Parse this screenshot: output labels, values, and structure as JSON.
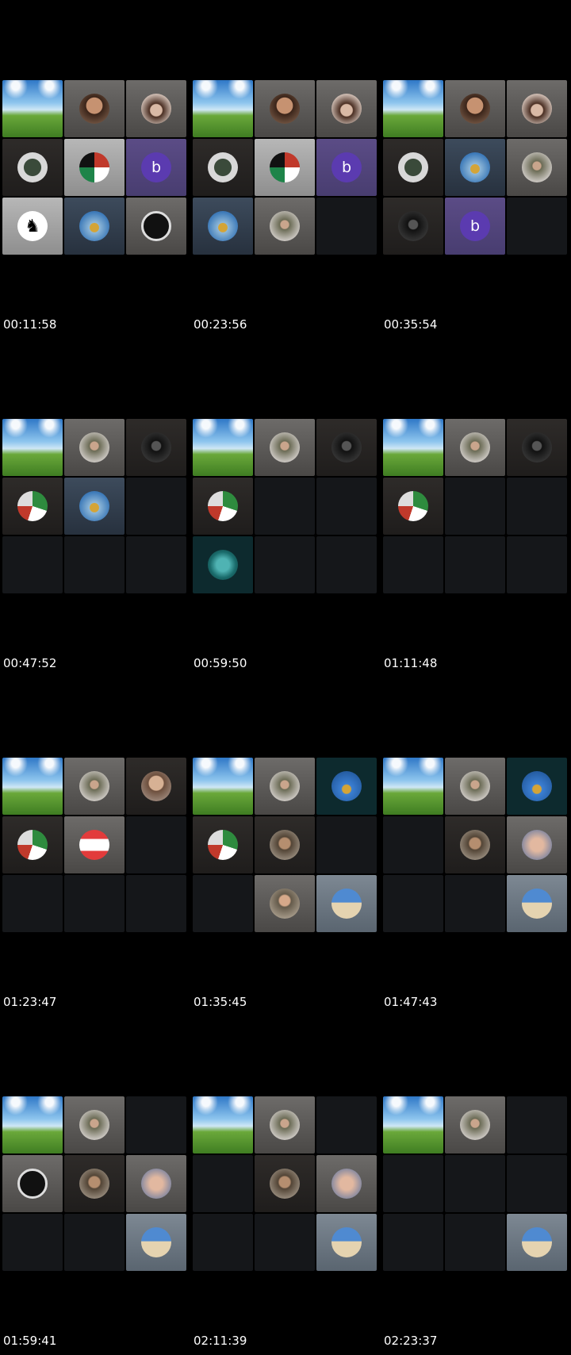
{
  "frames": [
    {
      "timestamp": "00:11:58",
      "tiles": [
        {
          "bg": "stadium",
          "avatar": null
        },
        {
          "bg": "grey",
          "avatar": "man"
        },
        {
          "bg": "grey",
          "avatar": "girl"
        },
        {
          "bg": "dark",
          "avatar": "soldiers"
        },
        {
          "bg": "light",
          "avatar": "flags"
        },
        {
          "bg": "purple",
          "avatar": "letter",
          "letter": "b"
        },
        {
          "bg": "light",
          "avatar": "horse"
        },
        {
          "bg": "blue",
          "avatar": "dome"
        },
        {
          "bg": "grey",
          "avatar": "default"
        }
      ]
    },
    {
      "timestamp": "00:23:56",
      "tiles": [
        {
          "bg": "stadium",
          "avatar": null
        },
        {
          "bg": "grey",
          "avatar": "man"
        },
        {
          "bg": "grey",
          "avatar": "girl"
        },
        {
          "bg": "dark",
          "avatar": "soldiers"
        },
        {
          "bg": "light",
          "avatar": "flags"
        },
        {
          "bg": "purple",
          "avatar": "letter",
          "letter": "b"
        },
        {
          "bg": "blue",
          "avatar": "dome"
        },
        {
          "bg": "grey",
          "avatar": "fighter"
        },
        {
          "bg": "empty",
          "avatar": null
        }
      ]
    },
    {
      "timestamp": "00:35:54",
      "tiles": [
        {
          "bg": "stadium",
          "avatar": null
        },
        {
          "bg": "grey",
          "avatar": "man"
        },
        {
          "bg": "grey",
          "avatar": "girl"
        },
        {
          "bg": "dark",
          "avatar": "soldiers"
        },
        {
          "bg": "blue",
          "avatar": "dome"
        },
        {
          "bg": "grey",
          "avatar": "fighter"
        },
        {
          "bg": "dark",
          "avatar": "masked"
        },
        {
          "bg": "purple",
          "avatar": "letter",
          "letter": "b"
        },
        {
          "bg": "empty",
          "avatar": null
        }
      ]
    },
    {
      "timestamp": "00:47:52",
      "tiles": [
        {
          "bg": "stadium",
          "avatar": null
        },
        {
          "bg": "grey",
          "avatar": "fighter"
        },
        {
          "bg": "dark",
          "avatar": "masked"
        },
        {
          "bg": "dark",
          "avatar": "keffiyeh"
        },
        {
          "bg": "blue",
          "avatar": "dome"
        },
        {
          "bg": "empty",
          "avatar": null
        },
        {
          "bg": "empty",
          "avatar": null
        },
        {
          "bg": "empty",
          "avatar": null
        },
        {
          "bg": "empty",
          "avatar": null
        }
      ]
    },
    {
      "timestamp": "00:59:50",
      "tiles": [
        {
          "bg": "stadium",
          "avatar": null
        },
        {
          "bg": "grey",
          "avatar": "fighter"
        },
        {
          "bg": "dark",
          "avatar": "masked"
        },
        {
          "bg": "dark",
          "avatar": "keffiyeh"
        },
        {
          "bg": "empty",
          "avatar": null
        },
        {
          "bg": "empty",
          "avatar": null
        },
        {
          "bg": "teal",
          "avatar": "teal"
        },
        {
          "bg": "empty",
          "avatar": null
        },
        {
          "bg": "empty",
          "avatar": null
        }
      ]
    },
    {
      "timestamp": "01:11:48",
      "tiles": [
        {
          "bg": "stadium",
          "avatar": null
        },
        {
          "bg": "grey",
          "avatar": "fighter"
        },
        {
          "bg": "dark",
          "avatar": "masked"
        },
        {
          "bg": "dark",
          "avatar": "keffiyeh"
        },
        {
          "bg": "empty",
          "avatar": null
        },
        {
          "bg": "empty",
          "avatar": null
        },
        {
          "bg": "empty",
          "avatar": null
        },
        {
          "bg": "empty",
          "avatar": null
        },
        {
          "bg": "empty",
          "avatar": null
        }
      ]
    },
    {
      "timestamp": "01:23:47",
      "tiles": [
        {
          "bg": "stadium",
          "avatar": null
        },
        {
          "bg": "grey",
          "avatar": "fighter"
        },
        {
          "bg": "dark",
          "avatar": "man2"
        },
        {
          "bg": "dark",
          "avatar": "keffiyeh"
        },
        {
          "bg": "grey",
          "avatar": "lebanon"
        },
        {
          "bg": "empty",
          "avatar": null
        },
        {
          "bg": "empty",
          "avatar": null
        },
        {
          "bg": "empty",
          "avatar": null
        },
        {
          "bg": "empty",
          "avatar": null
        }
      ]
    },
    {
      "timestamp": "01:35:45",
      "tiles": [
        {
          "bg": "stadium",
          "avatar": null
        },
        {
          "bg": "grey",
          "avatar": "fighter"
        },
        {
          "bg": "teal",
          "avatar": "flagdome"
        },
        {
          "bg": "dark",
          "avatar": "keffiyeh"
        },
        {
          "bg": "dark",
          "avatar": "men"
        },
        {
          "bg": "empty",
          "avatar": null
        },
        {
          "bg": "empty",
          "avatar": null
        },
        {
          "bg": "grey",
          "avatar": "selfie"
        },
        {
          "bg": "steel",
          "avatar": "beach"
        }
      ]
    },
    {
      "timestamp": "01:47:43",
      "tiles": [
        {
          "bg": "stadium",
          "avatar": null
        },
        {
          "bg": "grey",
          "avatar": "fighter"
        },
        {
          "bg": "teal",
          "avatar": "flagdome"
        },
        {
          "bg": "empty",
          "avatar": null
        },
        {
          "bg": "dark",
          "avatar": "men"
        },
        {
          "bg": "grey",
          "avatar": "hands"
        },
        {
          "bg": "empty",
          "avatar": null
        },
        {
          "bg": "empty",
          "avatar": null
        },
        {
          "bg": "steel",
          "avatar": "beach"
        }
      ]
    },
    {
      "timestamp": "01:59:41",
      "tiles": [
        {
          "bg": "stadium",
          "avatar": null
        },
        {
          "bg": "grey",
          "avatar": "fighter"
        },
        {
          "bg": "empty",
          "avatar": null
        },
        {
          "bg": "grey",
          "avatar": "default"
        },
        {
          "bg": "dark",
          "avatar": "men"
        },
        {
          "bg": "grey",
          "avatar": "hands"
        },
        {
          "bg": "empty",
          "avatar": null
        },
        {
          "bg": "empty",
          "avatar": null
        },
        {
          "bg": "steel",
          "avatar": "beach"
        }
      ]
    },
    {
      "timestamp": "02:11:39",
      "tiles": [
        {
          "bg": "stadium",
          "avatar": null
        },
        {
          "bg": "grey",
          "avatar": "fighter"
        },
        {
          "bg": "empty",
          "avatar": null
        },
        {
          "bg": "empty",
          "avatar": null
        },
        {
          "bg": "dark",
          "avatar": "men"
        },
        {
          "bg": "grey",
          "avatar": "hands"
        },
        {
          "bg": "empty",
          "avatar": null
        },
        {
          "bg": "empty",
          "avatar": null
        },
        {
          "bg": "steel",
          "avatar": "beach"
        }
      ]
    },
    {
      "timestamp": "02:23:37",
      "tiles": [
        {
          "bg": "stadium",
          "avatar": null
        },
        {
          "bg": "grey",
          "avatar": "fighter"
        },
        {
          "bg": "empty",
          "avatar": null
        },
        {
          "bg": "empty",
          "avatar": null
        },
        {
          "bg": "empty",
          "avatar": null
        },
        {
          "bg": "empty",
          "avatar": null
        },
        {
          "bg": "empty",
          "avatar": null
        },
        {
          "bg": "empty",
          "avatar": null
        },
        {
          "bg": "steel",
          "avatar": "beach"
        }
      ]
    }
  ]
}
